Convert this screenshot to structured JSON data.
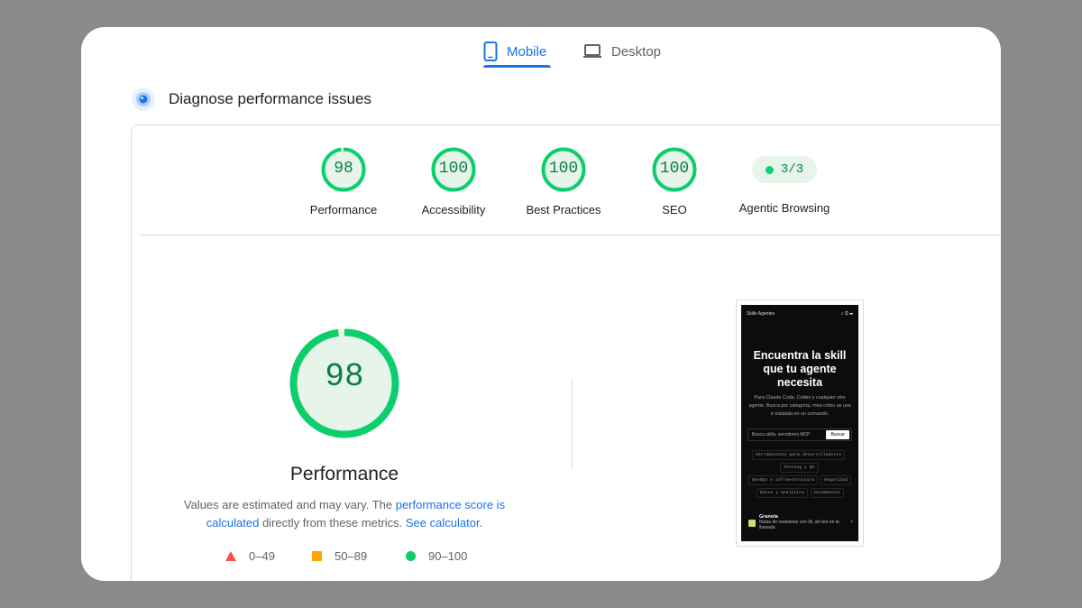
{
  "tabs": {
    "mobile": "Mobile",
    "desktop": "Desktop",
    "active": "mobile"
  },
  "diagnose": {
    "title": "Diagnose performance issues"
  },
  "scores": [
    {
      "label": "Performance",
      "value": "98",
      "fraction": 0.98
    },
    {
      "label": "Accessibility",
      "value": "100",
      "fraction": 1.0
    },
    {
      "label": "Best Practices",
      "value": "100",
      "fraction": 1.0
    },
    {
      "label": "SEO",
      "value": "100",
      "fraction": 1.0
    }
  ],
  "agentic": {
    "label": "Agentic Browsing",
    "value": "3/3"
  },
  "main": {
    "score": "98",
    "score_fraction": 0.98,
    "title": "Performance",
    "desc_1": "Values are estimated and may vary. The ",
    "desc_link_1": "performance score is calculated",
    "desc_2": " directly from these metrics. ",
    "desc_link_2": "See calculator",
    "desc_3": "."
  },
  "legend": {
    "fail": "0–49",
    "average": "50–89",
    "pass": "90–100"
  },
  "colors": {
    "accent": "#1a73e8",
    "pass": "#0cce6b",
    "pass_text": "#0b8043",
    "pass_bg": "#e6f4ea",
    "average": "#ffa400",
    "fail": "#ff4e42"
  },
  "preview": {
    "app_title": "Skills Agentes",
    "heading": "Encuentra la skill que tu agente necesita",
    "subtitle": "Para Claude Code, Codex y cualquier otro agente. Busca por categoría, mira cómo se usa e instálala en un comando.",
    "search_placeholder": "Busca skills, servidores MCP",
    "search_button": "Buscar",
    "chips": [
      "Herramientas para desarrolladores",
      "Testing y QA",
      "DevOps e infraestructura",
      "Seguridad",
      "Datos y analítica",
      "Documentos"
    ],
    "card_title": "Granola",
    "card_text": "Notas de reuniones con IA, sin bot en la llamada"
  }
}
